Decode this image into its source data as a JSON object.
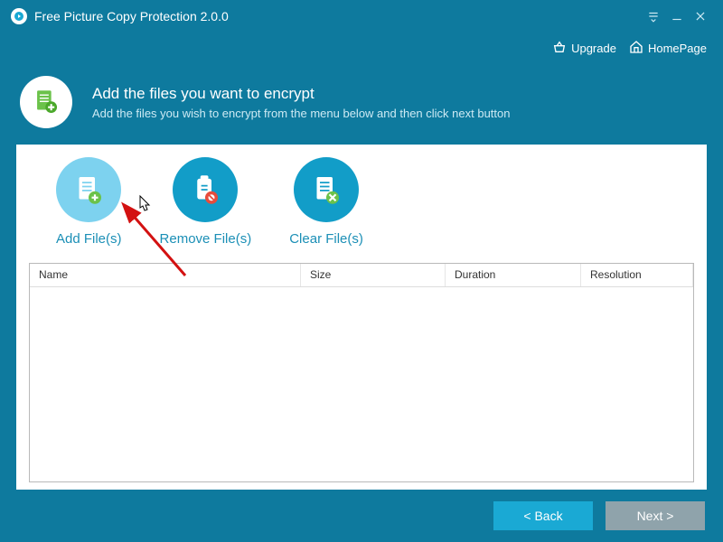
{
  "titlebar": {
    "title": "Free Picture Copy Protection 2.0.0"
  },
  "toolbar": {
    "upgrade": "Upgrade",
    "homepage": "HomePage"
  },
  "header": {
    "title": "Add the files you want to encrypt",
    "subtitle": "Add the files you wish to encrypt from the menu below and then click next button"
  },
  "actions": {
    "add": "Add File(s)",
    "remove": "Remove File(s)",
    "clear": "Clear File(s)"
  },
  "table": {
    "cols": {
      "name": "Name",
      "size": "Size",
      "duration": "Duration",
      "resolution": "Resolution"
    }
  },
  "footer": {
    "back": "< Back",
    "next": "Next >"
  }
}
